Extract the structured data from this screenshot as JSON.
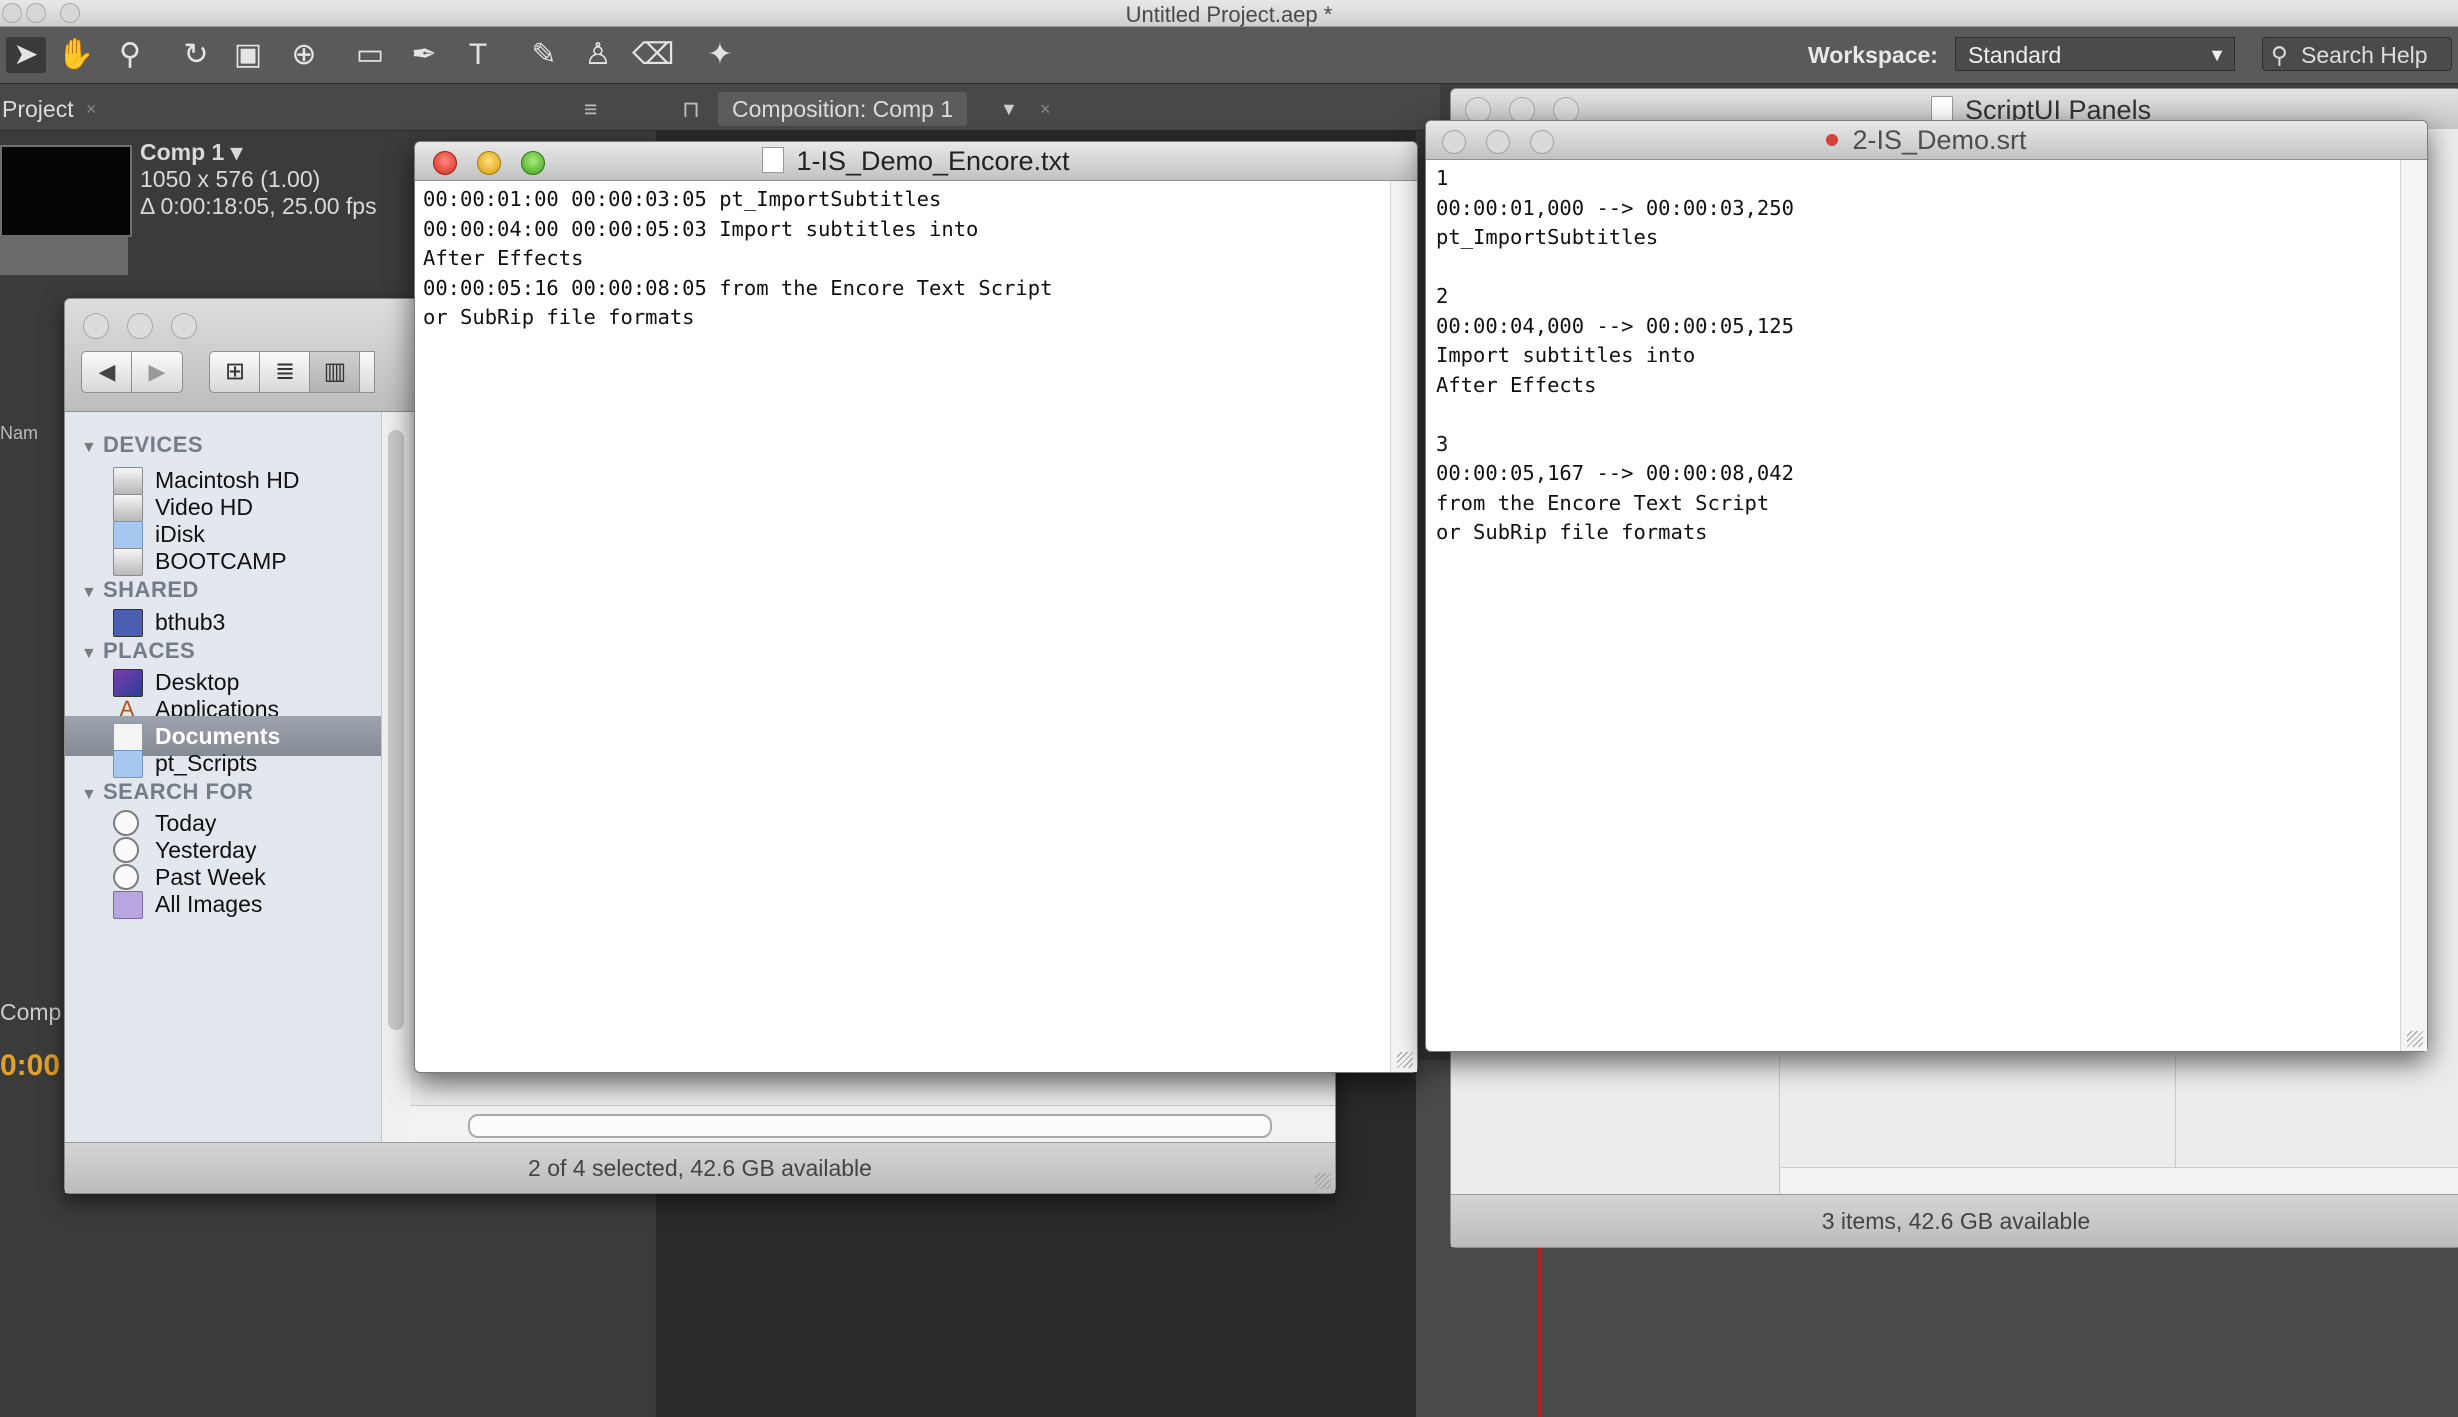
{
  "app": {
    "title": "Untitled Project.aep *",
    "workspace_label": "Workspace:",
    "workspace_value": "Standard",
    "search_placeholder": "Search Help"
  },
  "tabs": {
    "project": "Project",
    "composition": "Composition: Comp 1"
  },
  "comp_info": {
    "name": "Comp 1 ▾",
    "size": "1050 x 576 (1.00)",
    "duration": "Δ 0:00:18:05, 25.00 fps"
  },
  "finder": {
    "sidebar": {
      "devices_header": "DEVICES",
      "devices": [
        "Macintosh HD",
        "Video HD",
        "iDisk",
        "BOOTCAMP"
      ],
      "shared_header": "SHARED",
      "shared": [
        "bthub3"
      ],
      "places_header": "PLACES",
      "places": [
        "Desktop",
        "Applications",
        "Documents",
        "pt_Scripts"
      ],
      "search_header": "SEARCH FOR",
      "search": [
        "Today",
        "Yesterday",
        "Past Week",
        "All Images"
      ]
    },
    "status": "2 of 4 selected, 42.6 GB available"
  },
  "finder2": {
    "title": "ScriptUI Panels",
    "status": "3 items, 42.6 GB available"
  },
  "doc1": {
    "title": "1-IS_Demo_Encore.txt",
    "content": "00:00:01:00 00:00:03:05 pt_ImportSubtitles\n00:00:04:00 00:00:05:03 Import subtitles into\nAfter Effects\n00:00:05:16 00:00:08:05 from the Encore Text Script\nor SubRip file formats"
  },
  "doc2": {
    "title": "2-IS_Demo.srt",
    "content": "1\n00:00:01,000 --> 00:00:03,250\npt_ImportSubtitles\n\n2\n00:00:04,000 --> 00:00:05,125\nImport subtitles into\nAfter Effects\n\n3\n00:00:05,167 --> 00:00:08,042\nfrom the Encore Text Script\nor SubRip file formats"
  },
  "ae_bits": {
    "timecode": "0:00",
    "comp_label": "Comp",
    "name_col": "Nam"
  },
  "colors": {
    "ae_bg": "#3d3d3d",
    "timecode": "#e0a12b",
    "selection": "#8d939c",
    "close_red": "#d1281c"
  }
}
